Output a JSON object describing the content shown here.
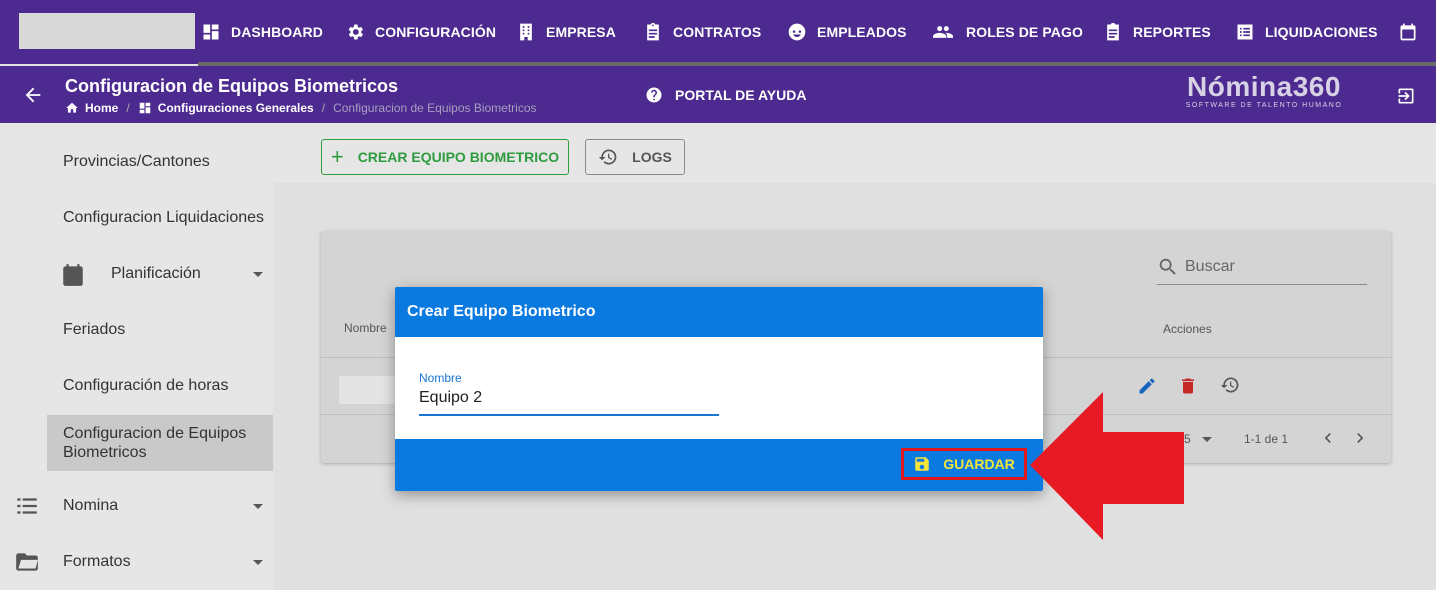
{
  "nav": {
    "items": [
      {
        "label": "DASHBOARD",
        "icon": "dashboard-icon"
      },
      {
        "label": "CONFIGURACIÓN",
        "icon": "gear-icon"
      },
      {
        "label": "EMPRESA",
        "icon": "building-icon"
      },
      {
        "label": "CONTRATOS",
        "icon": "clipboard-icon"
      },
      {
        "label": "EMPLEADOS",
        "icon": "face-icon"
      },
      {
        "label": "ROLES DE PAGO",
        "icon": "people-icon"
      },
      {
        "label": "REPORTES",
        "icon": "report-icon"
      },
      {
        "label": "LIQUIDACIONES",
        "icon": "list-icon"
      }
    ]
  },
  "header": {
    "title": "Configuracion de Equipos Biometricos",
    "breadcrumbs": [
      "Home",
      "Configuraciones Generales",
      "Configuracion de Equipos Biometricos"
    ],
    "help_label": "PORTAL DE AYUDA",
    "brand_name": "Nómina360",
    "brand_tagline": "SOFTWARE DE TALENTO HUMANO"
  },
  "sidebar": {
    "items": [
      {
        "label": "Provincias/Cantones"
      },
      {
        "label": "Configuracion Liquidaciones"
      },
      {
        "label": "Planificación"
      },
      {
        "label": "Feriados"
      },
      {
        "label": "Configuración de horas"
      },
      {
        "label": "Configuracion de Equipos Biometricos"
      },
      {
        "label": "Nomina"
      },
      {
        "label": "Formatos"
      }
    ]
  },
  "toolbar": {
    "create_label": "CREAR EQUIPO BIOMETRICO",
    "logs_label": "LOGS"
  },
  "table": {
    "search_placeholder": "Buscar",
    "headers": [
      "Nombre",
      "Acciones"
    ],
    "pagination": {
      "rows_per_page": "5",
      "range": "1-1 de 1"
    }
  },
  "dialog": {
    "title": "Crear Equipo Biometrico",
    "field_label": "Nombre",
    "field_value": "Equipo 2",
    "save_label": "GUARDAR"
  },
  "colors": {
    "nav_bg": "#4d2a8f",
    "dialog_blue": "#0a79e0",
    "create_green": "#2e9c3e",
    "highlight_red": "#e01a1a",
    "save_text": "#f4e53a"
  }
}
